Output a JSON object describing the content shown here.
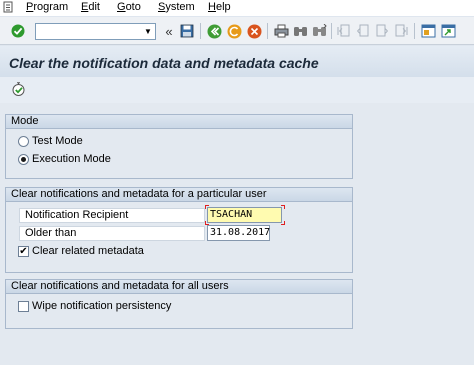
{
  "menu": {
    "items": [
      {
        "label": "Program",
        "mnemonic": "P",
        "rest": "rogram"
      },
      {
        "label": "Edit",
        "mnemonic": "E",
        "rest": "dit"
      },
      {
        "label": "Goto",
        "mnemonic": "G",
        "rest": "oto"
      },
      {
        "label": "System",
        "mnemonic": "S",
        "rest": "ystem"
      },
      {
        "label": "Help",
        "mnemonic": "H",
        "rest": "elp"
      }
    ]
  },
  "toolbar": {
    "command_field_value": "",
    "nav_arrows": "«"
  },
  "title": "Clear the notification data and metadata cache",
  "mode_group": {
    "title": "Mode",
    "options": [
      "Test Mode",
      "Execution Mode"
    ],
    "selected": "Execution Mode"
  },
  "user_group": {
    "title": "Clear notifications and metadata for a particular user",
    "recipient_label": "Notification Recipient",
    "recipient_value": "TSACHAN",
    "older_label": "Older than",
    "older_value": "31.08.2017",
    "related_label": "Clear related metadata",
    "related_checked": true
  },
  "all_group": {
    "title": "Clear notifications and metadata for all users",
    "wipe_label": "Wipe notification persistency",
    "wipe_checked": false
  },
  "colors": {
    "required_field": "#fffbb0",
    "focus_corner": "#e02020",
    "execute_green": "#2e9a2e"
  }
}
